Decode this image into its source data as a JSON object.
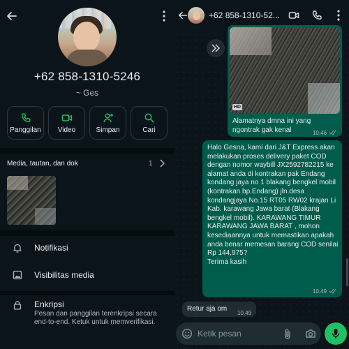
{
  "contact": {
    "phone": "+62 858-1310-5246",
    "name": "~ Ges"
  },
  "actions": [
    {
      "label": "Panggilan",
      "icon": "phone-icon"
    },
    {
      "label": "Video",
      "icon": "video-icon"
    },
    {
      "label": "Simpan",
      "icon": "add-person-icon"
    },
    {
      "label": "Cari",
      "icon": "search-icon"
    }
  ],
  "media": {
    "title": "Media, tautan, dan dok",
    "count": "1"
  },
  "settings": {
    "notifications": "Notifikasi",
    "media_visibility": "Visibilitas media",
    "encryption": "Enkripsi",
    "encryption_sub": "Pesan dan panggilan terenkripsi secara end-to-end. Ketuk untuk memverifikasi."
  },
  "chat": {
    "header_phone": "+62 858-1310-52...",
    "image_message": {
      "badge": "HD",
      "caption": "Alamatnya dmna ini yang ngontrak gak kenal",
      "time": "10.46"
    },
    "outgoing_message": {
      "text": "Halo Gesna, kami dari J&T Express akan melakukan proses delivery paket COD dengan nomor waybill JX2592782215 ke alamat anda di kontrakan pak Endang kondang jaya no 1 blakang bengkel mobil (kontrakan bp.Endang) jln.desa kondangjaya No.15 RT05 RW02 krajan Li Kab. karawang Jawa barat (Blakang bengkel mobil). KARAWANG TIMUR KARAWANG JAWA BARAT , mohon kesediaannya untuk memastikan apakah anda benar memesan barang COD senilai Rp 144,975?\nTerima kasih",
      "time": "10.49"
    },
    "incoming_message": {
      "text": "Retur aja om",
      "time": "10.49"
    },
    "input_placeholder": "Ketik pesan"
  },
  "colors": {
    "background": "#0b141a",
    "outgoing_bubble": "#005c4b",
    "incoming_bubble": "#1f2c33",
    "accent": "#21c063"
  }
}
